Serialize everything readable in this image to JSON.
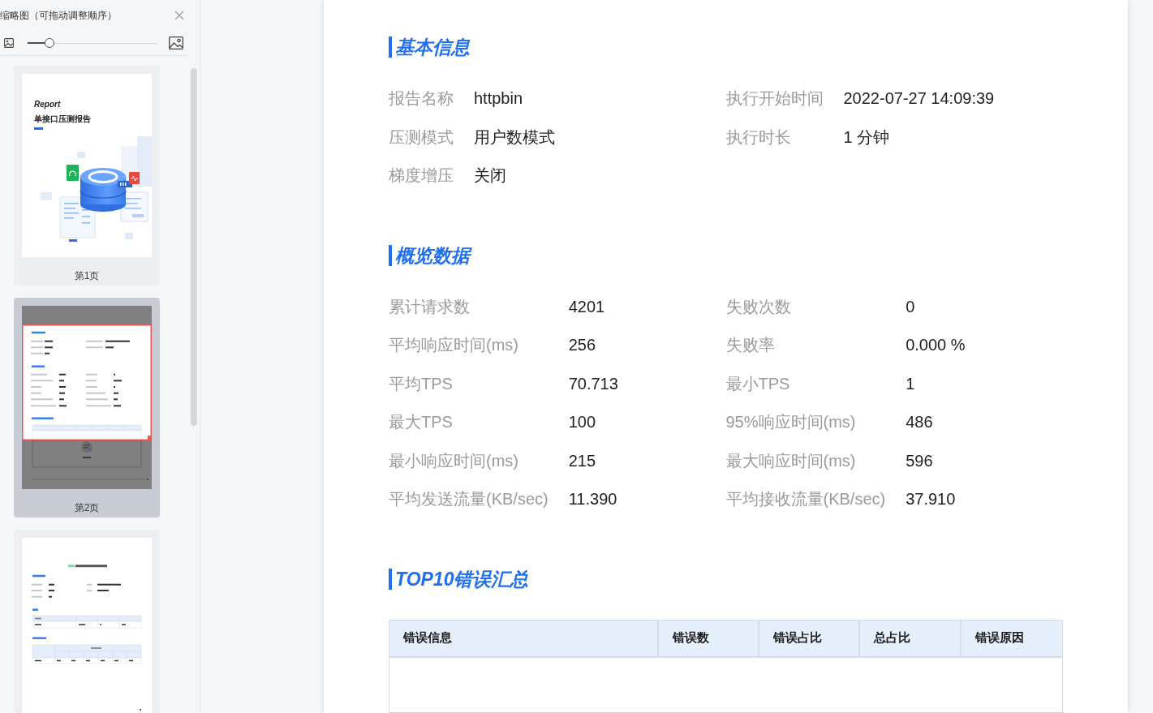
{
  "sidebar": {
    "title": "缩略图（可拖动调整顺序）",
    "zoom_slider": {
      "level": 0.17
    },
    "thumbnails": [
      {
        "kind": "cover",
        "label": "第1页",
        "selected": false,
        "cover_title": "Report",
        "cover_subtitle": "单接口压测报告"
      },
      {
        "kind": "summary",
        "label": "第2页",
        "selected": true
      },
      {
        "kind": "detail",
        "selected": false
      }
    ]
  },
  "document": {
    "sections": [
      {
        "kind": "fields",
        "title": "基本信息",
        "fields": [
          {
            "label": "报告名称",
            "value": "httpbin"
          },
          {
            "label": "执行开始时间",
            "value": "2022-07-27 14:09:39"
          },
          {
            "label": "压测模式",
            "value": "用户数模式"
          },
          {
            "label": "执行时长",
            "value": "1 分钟"
          },
          {
            "label": "梯度增压",
            "value": "关闭"
          }
        ]
      },
      {
        "kind": "fields",
        "title": "概览数据",
        "fields": [
          {
            "label": "累计请求数",
            "value": "4201"
          },
          {
            "label": "失败次数",
            "value": "0"
          },
          {
            "label": "平均响应时间(ms)",
            "value": "256"
          },
          {
            "label": "失败率",
            "value": "0.000 %"
          },
          {
            "label": "平均TPS",
            "value": "70.713"
          },
          {
            "label": "最小TPS",
            "value": "1"
          },
          {
            "label": "最大TPS",
            "value": "100"
          },
          {
            "label": "95%响应时间(ms)",
            "value": "486"
          },
          {
            "label": "最小响应时间(ms)",
            "value": "215"
          },
          {
            "label": "最大响应时间(ms)",
            "value": "596"
          },
          {
            "label": "平均发送流量(KB/sec)",
            "value": "11.390"
          },
          {
            "label": "平均接收流量(KB/sec)",
            "value": "37.910"
          }
        ]
      },
      {
        "kind": "table",
        "title": "TOP10错误汇总",
        "columns": [
          "错误信息",
          "错误数",
          "错误占比",
          "总占比",
          "错误原因"
        ]
      }
    ]
  }
}
